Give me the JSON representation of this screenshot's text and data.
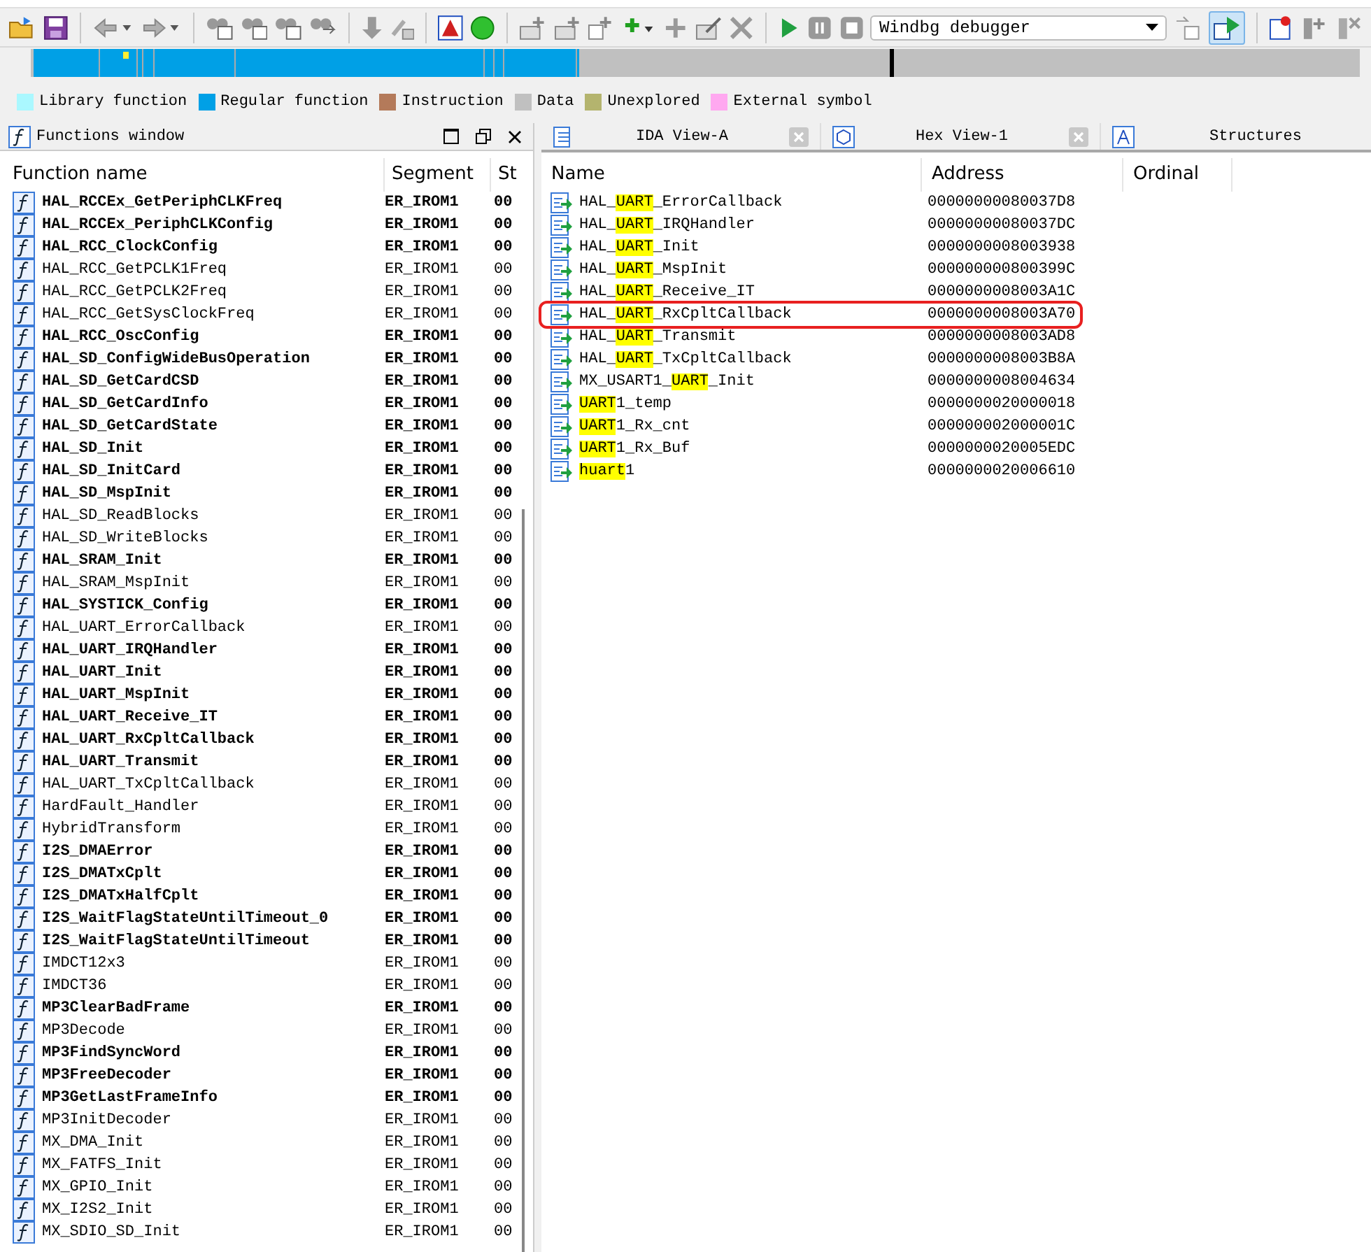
{
  "toolbar": {
    "debugger_select": {
      "value": "Windbg debugger"
    }
  },
  "legend": [
    {
      "label": "Library function",
      "color": "#aaf8ff"
    },
    {
      "label": "Regular function",
      "color": "#00a0e6"
    },
    {
      "label": "Instruction",
      "color": "#b47a5a"
    },
    {
      "label": "Data",
      "color": "#c0c0c0"
    },
    {
      "label": "Unexplored",
      "color": "#b4b46e"
    },
    {
      "label": "External symbol",
      "color": "#ffa8f0"
    }
  ],
  "functions_window": {
    "title": "Functions window",
    "columns": [
      "Function name",
      "Segment",
      "St"
    ],
    "rows": [
      {
        "name": "HAL_RCCEx_GetPeriphCLKFreq",
        "segment": "ER_IROM1",
        "column_3": "00",
        "bold": true
      },
      {
        "name": "HAL_RCCEx_PeriphCLKConfig",
        "segment": "ER_IROM1",
        "column_3": "00",
        "bold": true
      },
      {
        "name": "HAL_RCC_ClockConfig",
        "segment": "ER_IROM1",
        "column_3": "00",
        "bold": true
      },
      {
        "name": "HAL_RCC_GetPCLK1Freq",
        "segment": "ER_IROM1",
        "column_3": "00",
        "bold": false
      },
      {
        "name": "HAL_RCC_GetPCLK2Freq",
        "segment": "ER_IROM1",
        "column_3": "00",
        "bold": false
      },
      {
        "name": "HAL_RCC_GetSysClockFreq",
        "segment": "ER_IROM1",
        "column_3": "00",
        "bold": false
      },
      {
        "name": "HAL_RCC_OscConfig",
        "segment": "ER_IROM1",
        "column_3": "00",
        "bold": true
      },
      {
        "name": "HAL_SD_ConfigWideBusOperation",
        "segment": "ER_IROM1",
        "column_3": "00",
        "bold": true
      },
      {
        "name": "HAL_SD_GetCardCSD",
        "segment": "ER_IROM1",
        "column_3": "00",
        "bold": true
      },
      {
        "name": "HAL_SD_GetCardInfo",
        "segment": "ER_IROM1",
        "column_3": "00",
        "bold": true
      },
      {
        "name": "HAL_SD_GetCardState",
        "segment": "ER_IROM1",
        "column_3": "00",
        "bold": true
      },
      {
        "name": "HAL_SD_Init",
        "segment": "ER_IROM1",
        "column_3": "00",
        "bold": true
      },
      {
        "name": "HAL_SD_InitCard",
        "segment": "ER_IROM1",
        "column_3": "00",
        "bold": true
      },
      {
        "name": "HAL_SD_MspInit",
        "segment": "ER_IROM1",
        "column_3": "00",
        "bold": true
      },
      {
        "name": "HAL_SD_ReadBlocks",
        "segment": "ER_IROM1",
        "column_3": "00",
        "bold": false
      },
      {
        "name": "HAL_SD_WriteBlocks",
        "segment": "ER_IROM1",
        "column_3": "00",
        "bold": false
      },
      {
        "name": "HAL_SRAM_Init",
        "segment": "ER_IROM1",
        "column_3": "00",
        "bold": true
      },
      {
        "name": "HAL_SRAM_MspInit",
        "segment": "ER_IROM1",
        "column_3": "00",
        "bold": false
      },
      {
        "name": "HAL_SYSTICK_Config",
        "segment": "ER_IROM1",
        "column_3": "00",
        "bold": true
      },
      {
        "name": "HAL_UART_ErrorCallback",
        "segment": "ER_IROM1",
        "column_3": "00",
        "bold": false
      },
      {
        "name": "HAL_UART_IRQHandler",
        "segment": "ER_IROM1",
        "column_3": "00",
        "bold": true
      },
      {
        "name": "HAL_UART_Init",
        "segment": "ER_IROM1",
        "column_3": "00",
        "bold": true
      },
      {
        "name": "HAL_UART_MspInit",
        "segment": "ER_IROM1",
        "column_3": "00",
        "bold": true
      },
      {
        "name": "HAL_UART_Receive_IT",
        "segment": "ER_IROM1",
        "column_3": "00",
        "bold": true
      },
      {
        "name": "HAL_UART_RxCpltCallback",
        "segment": "ER_IROM1",
        "column_3": "00",
        "bold": true
      },
      {
        "name": "HAL_UART_Transmit",
        "segment": "ER_IROM1",
        "column_3": "00",
        "bold": true
      },
      {
        "name": "HAL_UART_TxCpltCallback",
        "segment": "ER_IROM1",
        "column_3": "00",
        "bold": false
      },
      {
        "name": "HardFault_Handler",
        "segment": "ER_IROM1",
        "column_3": "00",
        "bold": false
      },
      {
        "name": "HybridTransform",
        "segment": "ER_IROM1",
        "column_3": "00",
        "bold": false
      },
      {
        "name": "I2S_DMAError",
        "segment": "ER_IROM1",
        "column_3": "00",
        "bold": true
      },
      {
        "name": "I2S_DMATxCplt",
        "segment": "ER_IROM1",
        "column_3": "00",
        "bold": true
      },
      {
        "name": "I2S_DMATxHalfCplt",
        "segment": "ER_IROM1",
        "column_3": "00",
        "bold": true
      },
      {
        "name": "I2S_WaitFlagStateUntilTimeout_0",
        "segment": "ER_IROM1",
        "column_3": "00",
        "bold": true
      },
      {
        "name": "I2S_WaitFlagStateUntilTimeout",
        "segment": "ER_IROM1",
        "column_3": "00",
        "bold": true
      },
      {
        "name": "IMDCT12x3",
        "segment": "ER_IROM1",
        "column_3": "00",
        "bold": false
      },
      {
        "name": "IMDCT36",
        "segment": "ER_IROM1",
        "column_3": "00",
        "bold": false
      },
      {
        "name": "MP3ClearBadFrame",
        "segment": "ER_IROM1",
        "column_3": "00",
        "bold": true
      },
      {
        "name": "MP3Decode",
        "segment": "ER_IROM1",
        "column_3": "00",
        "bold": false
      },
      {
        "name": "MP3FindSyncWord",
        "segment": "ER_IROM1",
        "column_3": "00",
        "bold": true
      },
      {
        "name": "MP3FreeDecoder",
        "segment": "ER_IROM1",
        "column_3": "00",
        "bold": true
      },
      {
        "name": "MP3GetLastFrameInfo",
        "segment": "ER_IROM1",
        "column_3": "00",
        "bold": true
      },
      {
        "name": "MP3InitDecoder",
        "segment": "ER_IROM1",
        "column_3": "00",
        "bold": false
      },
      {
        "name": "MX_DMA_Init",
        "segment": "ER_IROM1",
        "column_3": "00",
        "bold": false
      },
      {
        "name": "MX_FATFS_Init",
        "segment": "ER_IROM1",
        "column_3": "00",
        "bold": false
      },
      {
        "name": "MX_GPIO_Init",
        "segment": "ER_IROM1",
        "column_3": "00",
        "bold": false
      },
      {
        "name": "MX_I2S2_Init",
        "segment": "ER_IROM1",
        "column_3": "00",
        "bold": false
      },
      {
        "name": "MX_SDIO_SD_Init",
        "segment": "ER_IROM1",
        "column_3": "00",
        "bold": false
      }
    ]
  },
  "tabs": [
    {
      "label": "IDA View-A",
      "selected": false
    },
    {
      "label": "Hex View-1",
      "selected": false
    },
    {
      "label": "Structures",
      "selected": false
    }
  ],
  "names_window": {
    "columns": [
      "Name",
      "Address",
      "Ordinal"
    ],
    "rows": [
      {
        "parts": [
          {
            "text": "HAL_",
            "match": false
          },
          {
            "text": "UART",
            "match": true
          },
          {
            "text": "_ErrorCallback",
            "match": false
          }
        ],
        "address": "00000000080037D8",
        "outlined": false
      },
      {
        "parts": [
          {
            "text": "HAL_",
            "match": false
          },
          {
            "text": "UART",
            "match": true
          },
          {
            "text": "_IRQHandler",
            "match": false
          }
        ],
        "address": "00000000080037DC",
        "outlined": false
      },
      {
        "parts": [
          {
            "text": "HAL_",
            "match": false
          },
          {
            "text": "UART",
            "match": true
          },
          {
            "text": "_Init",
            "match": false
          }
        ],
        "address": "0000000008003938",
        "outlined": false
      },
      {
        "parts": [
          {
            "text": "HAL_",
            "match": false
          },
          {
            "text": "UART",
            "match": true
          },
          {
            "text": "_MspInit",
            "match": false
          }
        ],
        "address": "000000000800399C",
        "outlined": false
      },
      {
        "parts": [
          {
            "text": "HAL_",
            "match": false
          },
          {
            "text": "UART",
            "match": true
          },
          {
            "text": "_Receive_IT",
            "match": false
          }
        ],
        "address": "0000000008003A1C",
        "outlined": false
      },
      {
        "parts": [
          {
            "text": "HAL_",
            "match": false
          },
          {
            "text": "UART",
            "match": true
          },
          {
            "text": "_RxCpltCallback",
            "match": false
          }
        ],
        "address": "0000000008003A70",
        "outlined": true
      },
      {
        "parts": [
          {
            "text": "HAL_",
            "match": false
          },
          {
            "text": "UART",
            "match": true
          },
          {
            "text": "_Transmit",
            "match": false
          }
        ],
        "address": "0000000008003AD8",
        "outlined": false
      },
      {
        "parts": [
          {
            "text": "HAL_",
            "match": false
          },
          {
            "text": "UART",
            "match": true
          },
          {
            "text": "_TxCpltCallback",
            "match": false
          }
        ],
        "address": "0000000008003B8A",
        "outlined": false
      },
      {
        "parts": [
          {
            "text": "MX_USART1_",
            "match": false
          },
          {
            "text": "UART",
            "match": true
          },
          {
            "text": "_Init",
            "match": false
          }
        ],
        "address": "0000000008004634",
        "outlined": false
      },
      {
        "parts": [
          {
            "text": "UART",
            "match": true
          },
          {
            "text": "1_temp",
            "match": false
          }
        ],
        "address": "0000000020000018",
        "outlined": false
      },
      {
        "parts": [
          {
            "text": "UART",
            "match": true
          },
          {
            "text": "1_Rx_cnt",
            "match": false
          }
        ],
        "address": "000000002000001C",
        "outlined": false
      },
      {
        "parts": [
          {
            "text": "UART",
            "match": true
          },
          {
            "text": "1_Rx_Buf",
            "match": false
          }
        ],
        "address": "0000000020005EDC",
        "outlined": false
      },
      {
        "parts": [
          {
            "text": "huart",
            "match": true
          },
          {
            "text": "1",
            "match": false
          }
        ],
        "address": "0000000020006610",
        "outlined": false
      }
    ]
  }
}
